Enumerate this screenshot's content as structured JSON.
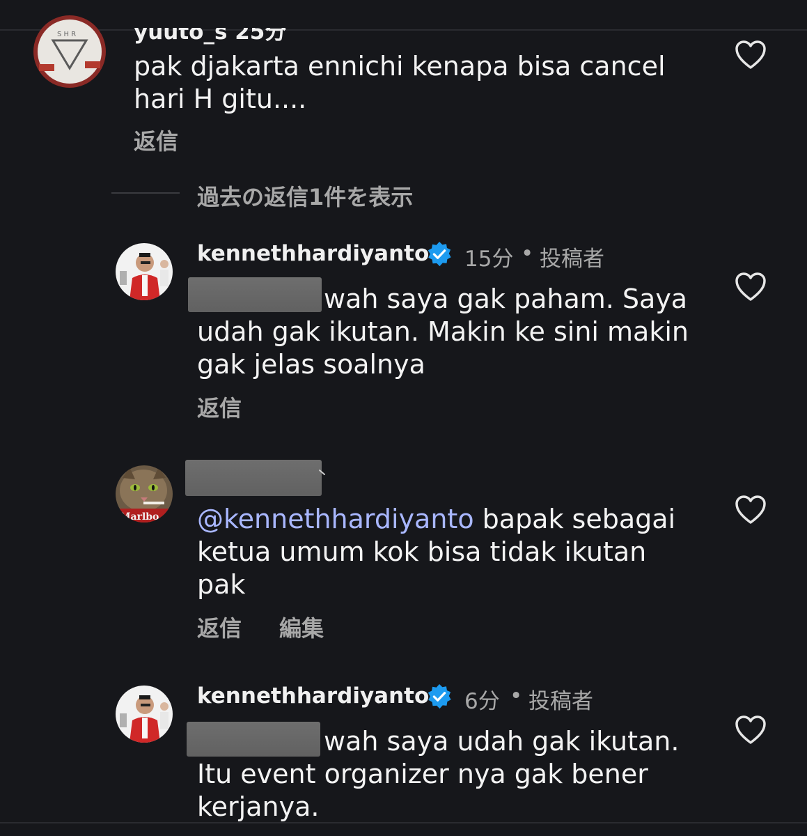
{
  "comment1": {
    "username_partial": "yuuto_s 25分",
    "lines": [
      "pak djakarta ennichi kenapa bisa cancel",
      "hari H gitu...."
    ],
    "reply_label": "返信"
  },
  "view_previous_replies": "過去の返信1件を表示",
  "reply1": {
    "username": "kennethhardiyanto",
    "time": "15分",
    "separator": "•",
    "author_badge": "投稿者",
    "lines": [
      "wah saya gak paham. Saya",
      "udah gak ikutan. Makin ke sini makin",
      "gak jelas soalnya"
    ],
    "reply_label": "返信"
  },
  "reply2": {
    "mention": "@kennethhardiyanto",
    "lines": [
      " bapak sebagai",
      "ketua umum kok bisa tidak ikutan",
      "pak"
    ],
    "reply_label": "返信",
    "edit_label": "編集"
  },
  "reply3": {
    "username": "kennethhardiyanto",
    "time": "6分",
    "separator": "•",
    "author_badge": "投稿者",
    "lines": [
      "wah saya udah gak ikutan.",
      "Itu event organizer nya gak bener",
      "kerjanya."
    ]
  },
  "colors": {
    "background": "#16171b",
    "verified": "#1d9bf0",
    "secondary_text": "#a8a8a8",
    "mention": "#a9b7ff"
  }
}
